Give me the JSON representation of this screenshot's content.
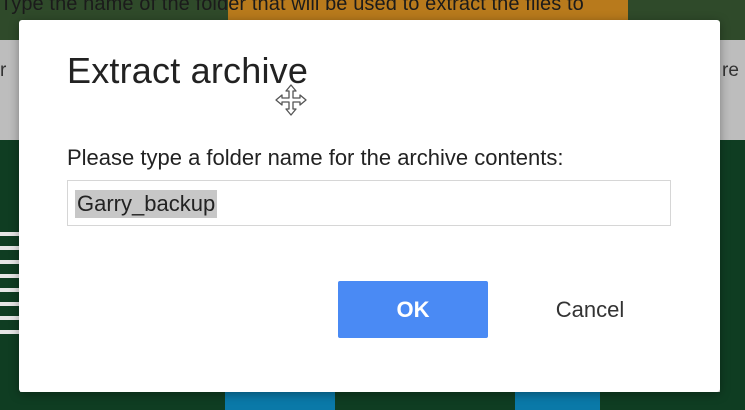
{
  "background": {
    "instruction_text": "Type the name of the folder that will be used to extract the files to",
    "left_fragment": "r",
    "right_fragment": "re"
  },
  "dialog": {
    "title": "Extract archive",
    "prompt": "Please type a folder name for the archive contents:",
    "input_value": "Garry_backup",
    "ok_label": "OK",
    "cancel_label": "Cancel"
  },
  "colors": {
    "primary_button": "#4a8af4",
    "dialog_background": "#ffffff",
    "selection_highlight": "#c7c7c7"
  },
  "icons": {
    "cursor": "move-cursor-icon"
  }
}
